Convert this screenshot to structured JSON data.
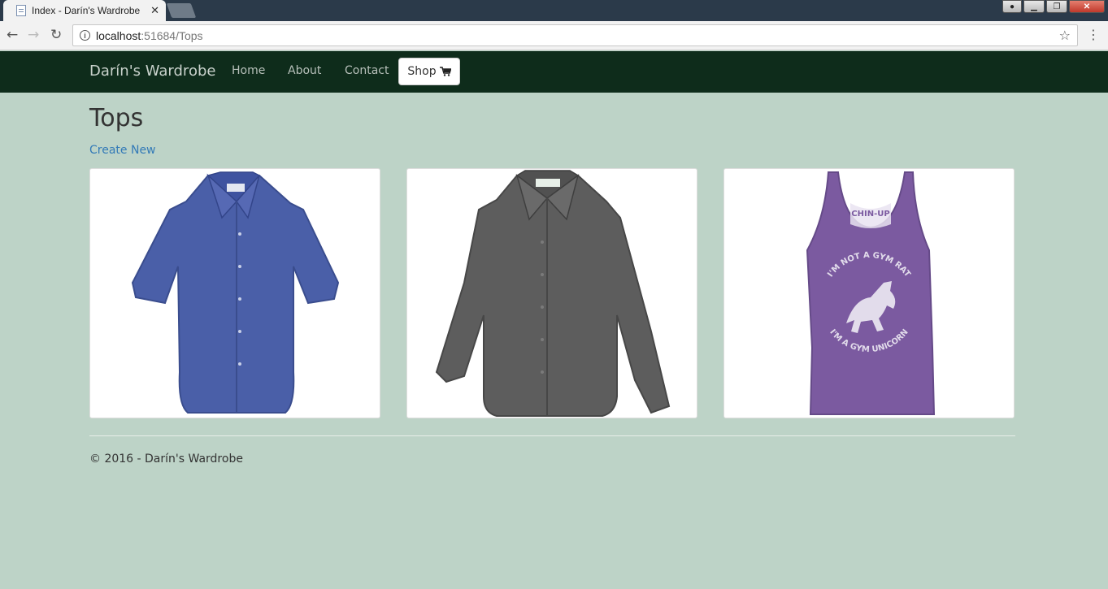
{
  "browser": {
    "tab_title": "Index - Darín's Wardrobe",
    "tab_close": "✕",
    "url_host": "localhost",
    "url_path": ":51684/Tops",
    "back_glyph": "←",
    "forward_glyph": "→",
    "reload_glyph": "↻",
    "star_glyph": "☆",
    "menu_glyph": "⋮"
  },
  "navbar": {
    "brand": "Darín's Wardrobe",
    "links": [
      "Home",
      "About",
      "Contact"
    ],
    "shop_label": "Shop"
  },
  "main": {
    "title": "Tops",
    "create_link": "Create New",
    "products": [
      {
        "name": "blue-short-sleeve-shirt",
        "color": "#4a5fa8"
      },
      {
        "name": "gray-long-sleeve-shirt",
        "color": "#5d5d5d"
      },
      {
        "name": "purple-tank-top",
        "color": "#7b5aa0",
        "print_top": "CHIN-UP",
        "print_ring_top": "I'M NOT A GYM RAT",
        "print_ring_bottom": "I'M A GYM UNICORN"
      }
    ]
  },
  "footer": {
    "text": "© 2016 - Darín's Wardrobe"
  },
  "colors": {
    "page_bg": "#bdd3c7",
    "nav_bg": "#0e2c1b",
    "link": "#337ab7"
  }
}
